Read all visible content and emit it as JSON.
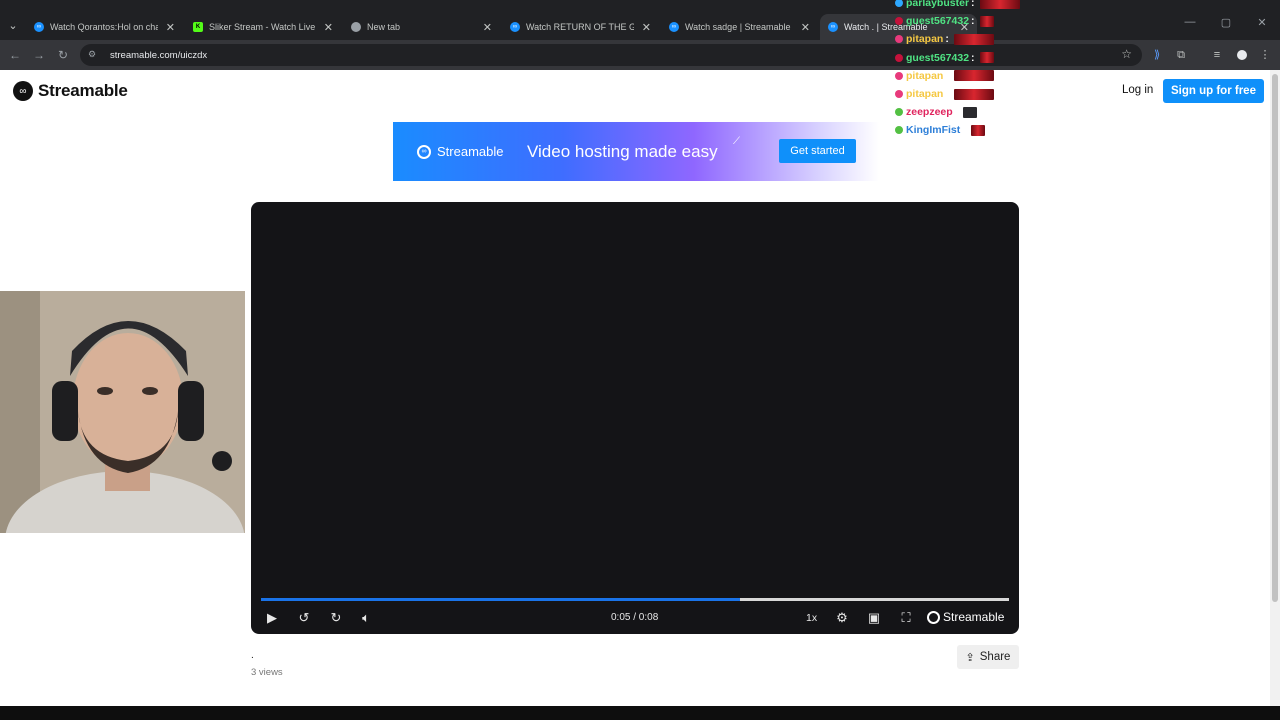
{
  "browser": {
    "tabs": [
      {
        "title": "Watch Qorantos:Hol on chat m",
        "favicon": "streamable-icon",
        "active": false
      },
      {
        "title": "Sliker Stream - Watch Live on K",
        "favicon": "kick-icon",
        "active": false
      },
      {
        "title": "New tab",
        "favicon": "chrome-icon",
        "active": false
      },
      {
        "title": "Watch RETURN OF THE GOAT",
        "favicon": "streamable-icon",
        "active": false
      },
      {
        "title": "Watch sadge | Streamable",
        "favicon": "streamable-icon",
        "active": false
      },
      {
        "title": "Watch . | Streamable",
        "favicon": "streamable-icon",
        "active": true
      }
    ],
    "url": "streamable.com/uiczdx"
  },
  "header": {
    "brand": "Streamable",
    "login": "Log in",
    "signup": "Sign up for free"
  },
  "banner": {
    "brand": "Streamable",
    "tagline": "Video hosting made easy",
    "cta": "Get started"
  },
  "player": {
    "time": "0:05 / 0:08",
    "progress_fraction": 0.64,
    "speed": "1x",
    "brand": "Streamable"
  },
  "video": {
    "title": ".",
    "views": "3 views",
    "share_label": "Share"
  },
  "chat": [
    {
      "user": "parlaybuster",
      "color": "#4fe383",
      "badge_color": "#2ea8ff",
      "emote": "red"
    },
    {
      "user": "guest567432",
      "color": "#4fe383",
      "badge_color": "#c4123b",
      "emote": "red-small"
    },
    {
      "user": "pitapan",
      "color": "#f5c842",
      "badge_color": "#e83a7c",
      "emote": "red"
    },
    {
      "user": "guest567432",
      "color": "#4fe383",
      "badge_color": "#c4123b",
      "emote": "red-small"
    },
    {
      "user": "pitapan",
      "color": "#f5c842",
      "badge_color": "#e83a7c",
      "emote": "red"
    },
    {
      "user": "pitapan",
      "color": "#f5c842",
      "badge_color": "#e83a7c",
      "emote": "red"
    },
    {
      "user": "zeepzeep",
      "color": "#e0245e",
      "badge_color": "#53c043",
      "emote": "dark"
    },
    {
      "user": "KingImFist",
      "color": "#2e7fd8",
      "badge_color": "#53c043",
      "emote": "red-small"
    }
  ],
  "colors": {
    "accent": "#0f90fa",
    "progress": "#1a73e8",
    "player_bg": "#141417"
  }
}
